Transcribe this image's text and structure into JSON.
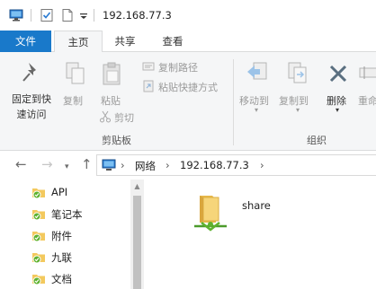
{
  "window": {
    "path_title": "192.168.77.3"
  },
  "ribbon_tabs": [
    "文件",
    "主页",
    "共享",
    "查看"
  ],
  "ribbon": {
    "pin_label_1": "固定到快",
    "pin_label_2": "速访问",
    "copy": "复制",
    "paste": "粘贴",
    "copy_path": "复制路径",
    "paste_shortcut": "粘贴快捷方式",
    "cut": "剪切",
    "clipboard_group": "剪贴板",
    "move_to": "移动到",
    "copy_to": "复制到",
    "delete": "删除",
    "rename": "重命",
    "organize_group": "组织"
  },
  "address": {
    "segments": [
      "网络",
      "192.168.77.3"
    ],
    "separator": "›"
  },
  "tree": {
    "items": [
      "API",
      "笔记本",
      "附件",
      "九联",
      "文档"
    ]
  },
  "content": {
    "items": [
      {
        "name": "share"
      }
    ]
  },
  "colors": {
    "file_tab": "#1979ca",
    "ribbon_bg": "#f5f6f7",
    "folder": "#f3c95e",
    "check_badge": "#5fb22f"
  }
}
